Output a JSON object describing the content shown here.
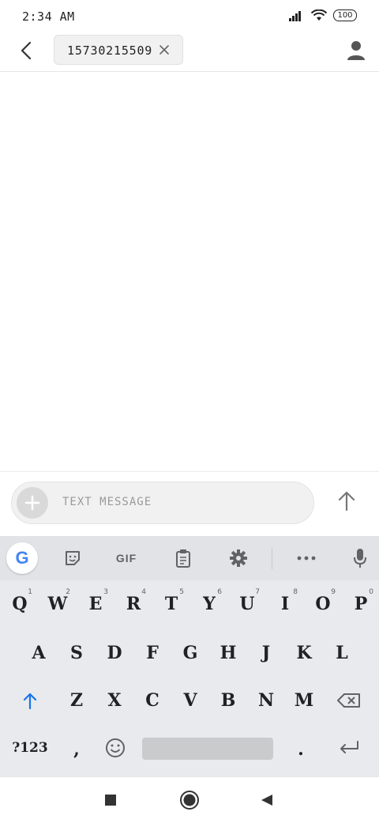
{
  "status_bar": {
    "time": "2:34 AM",
    "battery": "100"
  },
  "app_bar": {
    "recipient": "15730215509"
  },
  "compose": {
    "placeholder": "TEXT MESSAGE"
  },
  "keyboard": {
    "toolbar": {
      "gif_label": "GIF",
      "google_label": "G"
    },
    "rows": {
      "row1": [
        {
          "label": "Q",
          "hint": "1"
        },
        {
          "label": "W",
          "hint": "2"
        },
        {
          "label": "E",
          "hint": "3"
        },
        {
          "label": "R",
          "hint": "4"
        },
        {
          "label": "T",
          "hint": "5"
        },
        {
          "label": "Y",
          "hint": "6"
        },
        {
          "label": "U",
          "hint": "7"
        },
        {
          "label": "I",
          "hint": "8"
        },
        {
          "label": "O",
          "hint": "9"
        },
        {
          "label": "P",
          "hint": "0"
        }
      ],
      "row2": [
        "A",
        "S",
        "D",
        "F",
        "G",
        "H",
        "J",
        "K",
        "L"
      ],
      "row3": [
        "Z",
        "X",
        "C",
        "V",
        "B",
        "N",
        "M"
      ],
      "row4": {
        "symbols": "?123",
        "comma": ",",
        "period": "."
      }
    },
    "accent_color": "#1a73e8"
  }
}
